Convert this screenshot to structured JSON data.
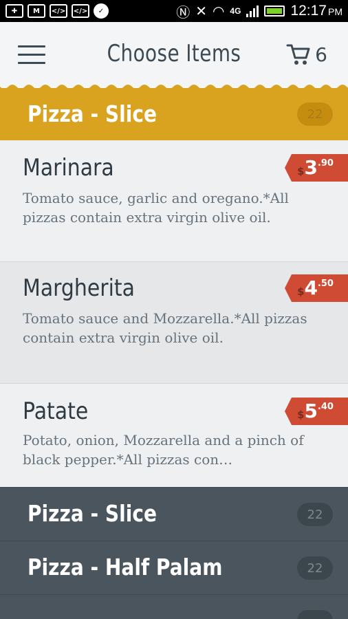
{
  "status_bar": {
    "icons": [
      "add-icon",
      "gmail-icon",
      "code-icon",
      "code-icon",
      "chat-icon",
      "nfc-icon",
      "mute-icon",
      "wifi-icon",
      "lte-icon",
      "signal-icon",
      "battery-icon"
    ],
    "network": "4G",
    "network_sub": "LTE",
    "time": "12:17",
    "ampm": "PM"
  },
  "appbar": {
    "title": "Choose Items",
    "cart_count": "6"
  },
  "colors": {
    "accent": "#d9a21f",
    "price_tag": "#cf4b34",
    "dark_category": "#4a555d",
    "text": "#3d4a54"
  },
  "open_category": {
    "title": "Pizza - Slice",
    "count": "22"
  },
  "items": [
    {
      "name": "Marinara",
      "description": "Tomato sauce, garlic and oregano.*All pizzas contain extra virgin olive oil.",
      "currency": "$",
      "price_int": "3",
      "price_dec": ".90"
    },
    {
      "name": "Margherita",
      "description": "Tomato sauce and Mozzarella.*All pizzas contain extra virgin olive oil.",
      "currency": "$",
      "price_int": "4",
      "price_dec": ".50"
    },
    {
      "name": "Patate",
      "description": "Potato, onion, Mozzarella and a pinch of black pepper.*All pizzas con…",
      "currency": "$",
      "price_int": "5",
      "price_dec": ".40"
    }
  ],
  "categories": [
    {
      "title": "Pizza - Slice",
      "count": "22"
    },
    {
      "title": "Pizza - Half Palam",
      "count": "22"
    },
    {
      "title": "",
      "count": ""
    }
  ]
}
